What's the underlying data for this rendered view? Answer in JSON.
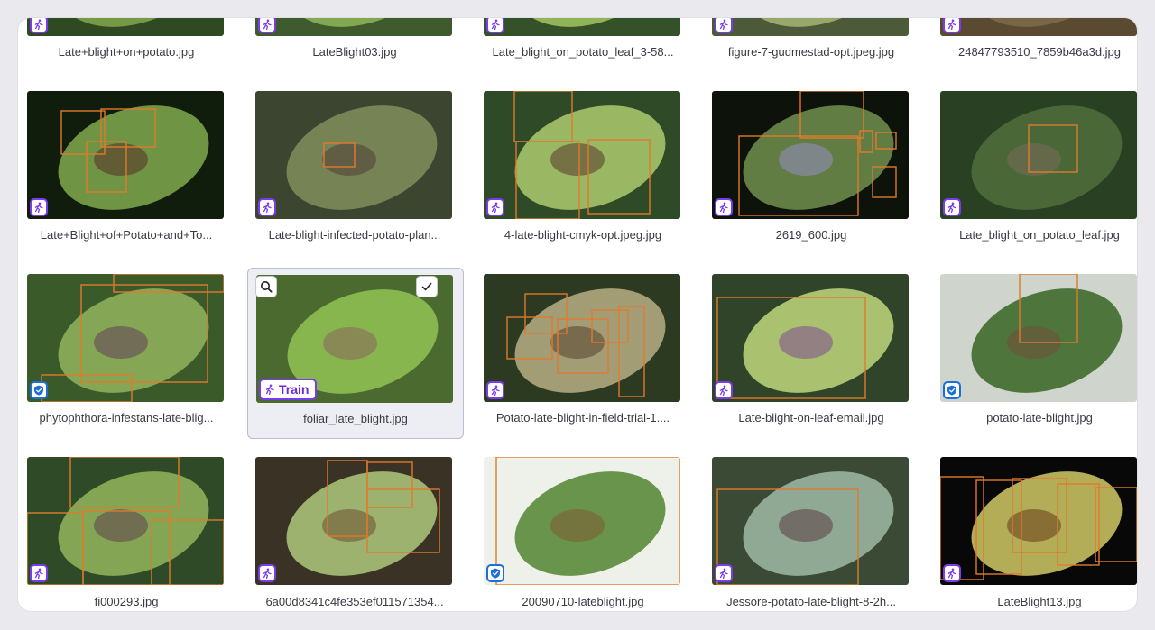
{
  "rows": [
    {
      "items": [
        {
          "filename": "Late+blight+on+potato.jpg",
          "split": "unassigned",
          "theme": "a"
        },
        {
          "filename": "LateBlight03.jpg",
          "split": "unassigned",
          "theme": "b"
        },
        {
          "filename": "Late_blight_on_potato_leaf_3-58...",
          "split": "unassigned",
          "theme": "c"
        },
        {
          "filename": "figure-7-gudmestad-opt.jpeg.jpg",
          "split": "unassigned",
          "theme": "d"
        },
        {
          "filename": "24847793510_7859b46a3d.jpg",
          "split": "unassigned",
          "theme": "e"
        }
      ]
    },
    {
      "items": [
        {
          "filename": "Late+Blight+of+Potato+and+To...",
          "split": "unassigned",
          "theme": "f"
        },
        {
          "filename": "Late-blight-infected-potato-plan...",
          "split": "unassigned",
          "theme": "g"
        },
        {
          "filename": "4-late-blight-cmyk-opt.jpeg.jpg",
          "split": "unassigned",
          "theme": "h"
        },
        {
          "filename": "2619_600.jpg",
          "split": "unassigned",
          "theme": "i"
        },
        {
          "filename": "Late_blight_on_potato_leaf.jpg",
          "split": "unassigned",
          "theme": "j"
        }
      ]
    },
    {
      "items": [
        {
          "filename": "phytophthora-infestans-late-blig...",
          "split": "valid",
          "theme": "k"
        },
        {
          "filename": "foliar_late_blight.jpg",
          "split": "train",
          "theme": "l",
          "selected": true
        },
        {
          "filename": "Potato-late-blight-in-field-trial-1....",
          "split": "unassigned",
          "theme": "m"
        },
        {
          "filename": "Late-blight-on-leaf-email.jpg",
          "split": "unassigned",
          "theme": "n"
        },
        {
          "filename": "potato-late-blight.jpg",
          "split": "valid",
          "theme": "o"
        }
      ]
    },
    {
      "items": [
        {
          "filename": "fi000293.jpg",
          "split": "unassigned",
          "theme": "p"
        },
        {
          "filename": "6a00d8341c4fe353ef011571354...",
          "split": "unassigned",
          "theme": "q"
        },
        {
          "filename": "20090710-lateblight.jpg",
          "split": "valid",
          "theme": "r"
        },
        {
          "filename": "Jessore-potato-late-blight-8-2h...",
          "split": "unassigned",
          "theme": "s"
        },
        {
          "filename": "LateBlight13.jpg",
          "split": "unassigned",
          "theme": "t"
        }
      ]
    }
  ],
  "train_label": "Train",
  "icons": {
    "unassigned": "person-walking-icon",
    "valid": "shield-check-icon",
    "train": "person-walking-icon",
    "zoom": "magnifier-icon",
    "select": "checkmark-icon"
  },
  "colors": {
    "train_accent": "#7c3aed",
    "valid_accent": "#1d6fd8",
    "bbox": "#e07a2c"
  }
}
